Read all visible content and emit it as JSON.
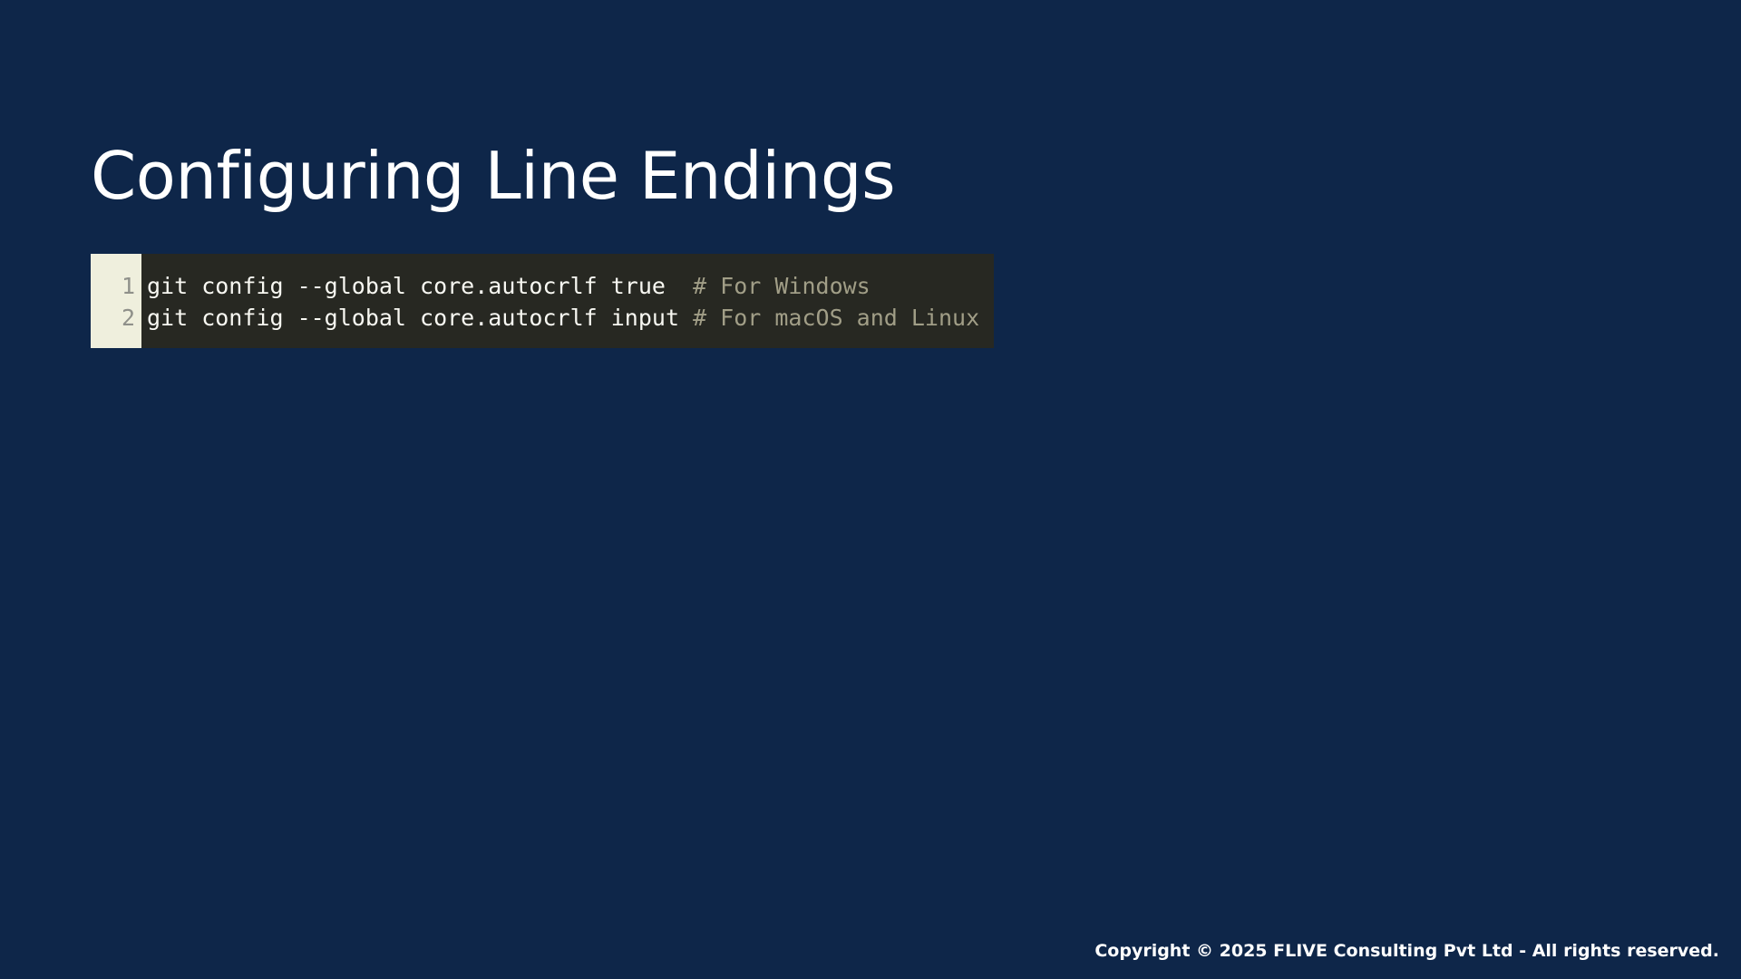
{
  "slide": {
    "title": "Configuring Line Endings"
  },
  "code_block": {
    "lines": [
      {
        "number": "1",
        "code": "git config --global core.autocrlf true  ",
        "comment": "# For Windows"
      },
      {
        "number": "2",
        "code": "git config --global core.autocrlf input ",
        "comment": "# For macOS and Linux"
      }
    ]
  },
  "footer": {
    "copyright": "Copyright © 2025 FLIVE Consulting Pvt Ltd - All rights reserved."
  },
  "colors": {
    "background": "#0e2649",
    "code_background": "#272822",
    "gutter_background": "#efefdd",
    "code_text": "#f8f8f2",
    "comment_text": "#a19e87",
    "line_number_text": "#8f908a"
  }
}
